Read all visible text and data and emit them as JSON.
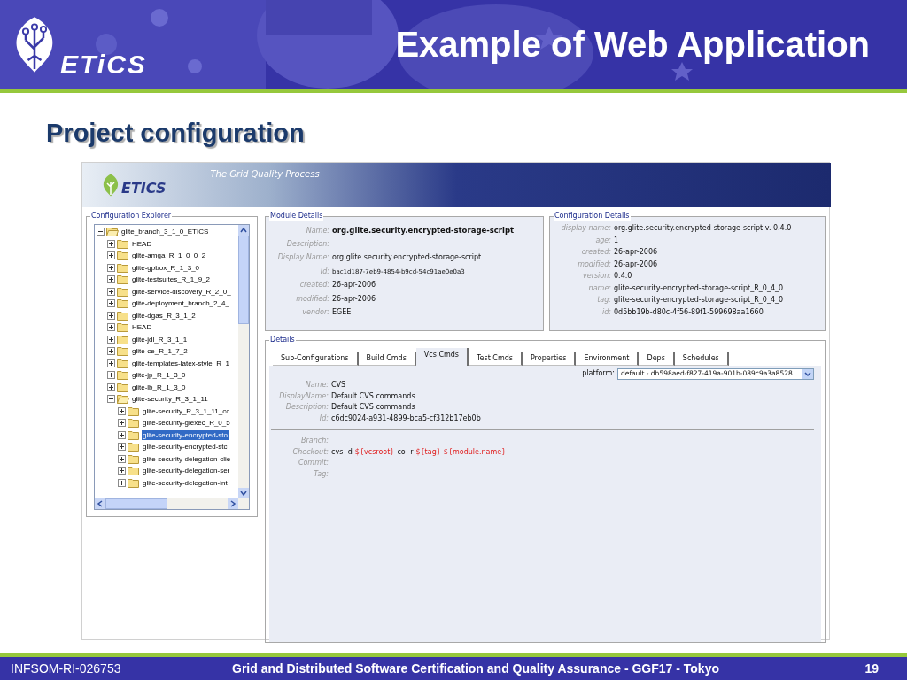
{
  "slide_header": {
    "logo_text": "ETiCS",
    "title": "Example of Web Application"
  },
  "subtitle": "Project configuration",
  "app": {
    "banner": {
      "logo_text": "ETICS",
      "tagline": "The Grid Quality Process"
    },
    "explorer": {
      "title": "Configuration Explorer",
      "tree": [
        {
          "label": "glite_branch_3_1_0_ETICS",
          "expanded": true,
          "selected": false,
          "children": [
            {
              "label": "HEAD",
              "expanded": false,
              "selected": false
            },
            {
              "label": "glite-amga_R_1_0_0_2",
              "expanded": false,
              "selected": false
            },
            {
              "label": "glite-gpbox_R_1_3_0",
              "expanded": false,
              "selected": false
            },
            {
              "label": "glite-testsuites_R_1_9_2",
              "expanded": false,
              "selected": false
            },
            {
              "label": "glite-service-discovery_R_2_0_",
              "expanded": false,
              "selected": false
            },
            {
              "label": "glite-deployment_branch_2_4_",
              "expanded": false,
              "selected": false
            },
            {
              "label": "glite-dgas_R_3_1_2",
              "expanded": false,
              "selected": false
            },
            {
              "label": "HEAD",
              "expanded": false,
              "selected": false
            },
            {
              "label": "glite-jdl_R_3_1_1",
              "expanded": false,
              "selected": false
            },
            {
              "label": "glite-ce_R_1_7_2",
              "expanded": false,
              "selected": false
            },
            {
              "label": "glite-templates-latex-style_R_1",
              "expanded": false,
              "selected": false
            },
            {
              "label": "glite-jp_R_1_3_0",
              "expanded": false,
              "selected": false
            },
            {
              "label": "glite-lb_R_1_3_0",
              "expanded": false,
              "selected": false
            },
            {
              "label": "glite-security_R_3_1_11",
              "expanded": true,
              "selected": false,
              "children": [
                {
                  "label": "glite-security_R_3_1_11_cc",
                  "expanded": false,
                  "selected": false
                },
                {
                  "label": "glite-security-glexec_R_0_5",
                  "expanded": false,
                  "selected": false
                },
                {
                  "label": "glite-security-encrypted-sto",
                  "expanded": false,
                  "selected": true
                },
                {
                  "label": "glite-security-encrypted-stc",
                  "expanded": false,
                  "selected": false
                },
                {
                  "label": "glite-security-delegation-clie",
                  "expanded": false,
                  "selected": false
                },
                {
                  "label": "glite-security-delegation-ser",
                  "expanded": false,
                  "selected": false
                },
                {
                  "label": "glite-security-delegation-int",
                  "expanded": false,
                  "selected": false
                }
              ]
            }
          ]
        }
      ]
    },
    "module_details": {
      "title": "Module Details",
      "fields": [
        {
          "label": "Name:",
          "value": "org.glite.security.encrypted-storage-script",
          "kind": "bold"
        },
        {
          "label": "Description:"
        },
        {
          "label": "Display Name:",
          "value": "org.glite.security.encrypted-storage-script",
          "kind": "plain"
        },
        {
          "label": "Id:",
          "value": "bac1d187-7eb9-4854-b9cd-54c91ae0e0a3",
          "kind": "small"
        },
        {
          "label": "created:",
          "value": "26-apr-2006",
          "kind": "plain"
        },
        {
          "label": "modified:",
          "value": "26-apr-2006",
          "kind": "plain"
        },
        {
          "label": "vendor:",
          "value": "EGEE",
          "kind": "plain"
        }
      ]
    },
    "configuration_details": {
      "title": "Configuration Details",
      "fields": [
        {
          "label": "display name:",
          "value": "org.glite.security.encrypted-storage-script v. 0.4.0"
        },
        {
          "label": "age:",
          "value": "1"
        },
        {
          "label": "created:",
          "value": "26-apr-2006"
        },
        {
          "label": "modified:",
          "value": "26-apr-2006"
        },
        {
          "label": "version:",
          "value": "0.4.0"
        },
        {
          "label": "name:",
          "value": "glite-security-encrypted-storage-script_R_0_4_0"
        },
        {
          "label": "tag:",
          "value": "glite-security-encrypted-storage-script_R_0_4_0"
        },
        {
          "label": "id:",
          "value": "0d5bb19b-d80c-4f56-89f1-599698aa1660"
        }
      ]
    },
    "details": {
      "title": "Details",
      "tabs": [
        {
          "label": "Sub-Configurations",
          "selected": false
        },
        {
          "label": "Build Cmds",
          "selected": false
        },
        {
          "label": "Vcs Cmds",
          "selected": true
        },
        {
          "label": "Test Cmds",
          "selected": false
        },
        {
          "label": "Properties",
          "selected": false
        },
        {
          "label": "Environment",
          "selected": false
        },
        {
          "label": "Deps",
          "selected": false
        },
        {
          "label": "Schedules",
          "selected": false
        }
      ],
      "platform": {
        "label": "platform:",
        "value": "default - db598aed-f827-419a-901b-089c9a3a8528"
      },
      "info_fields": [
        {
          "label": "Name:",
          "value": "CVS"
        },
        {
          "label": "DisplayName:",
          "value": "Default CVS commands"
        },
        {
          "label": "Description:",
          "value": "Default CVS commands"
        },
        {
          "label": "Id:",
          "value": "c6dc9024-a931-4899-bca5-cf312b17eb0b"
        }
      ],
      "command_fields": [
        {
          "label": "Branch:"
        },
        {
          "label": "Checkout:",
          "parts": [
            {
              "text": "cvs -d",
              "kind": "text"
            },
            {
              "text": "${vcsroot}",
              "kind": "variable"
            },
            {
              "text": "co -r",
              "kind": "text"
            },
            {
              "text": "${tag}",
              "kind": "variable"
            },
            {
              "text": "${module.name}",
              "kind": "variable"
            }
          ]
        },
        {
          "label": "Commit:"
        },
        {
          "label": "Tag:"
        }
      ]
    }
  },
  "footer": {
    "left": "INFSOM-RI-026753",
    "center": "Grid and Distributed Software Certification and Quality Assurance - GGF17 - Tokyo",
    "page": "19"
  }
}
